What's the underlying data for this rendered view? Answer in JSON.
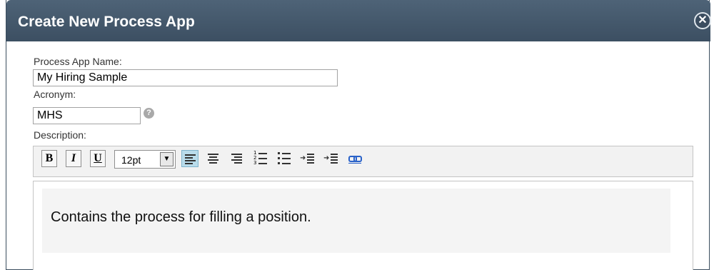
{
  "dialog": {
    "title": "Create New Process App",
    "close_icon": "close-icon"
  },
  "form": {
    "name_label": "Process App Name:",
    "name_value": "My Hiring Sample",
    "acronym_label": "Acronym:",
    "acronym_value": "MHS",
    "help_icon": "help-icon",
    "help_glyph": "?",
    "description_label": "Description:"
  },
  "toolbar": {
    "bold_label": "B",
    "italic_label": "I",
    "underline_label": "U",
    "font_size": "12pt",
    "icons": [
      "align-left-icon",
      "align-center-icon",
      "align-right-icon",
      "numbered-list-icon",
      "bullet-list-icon",
      "indent-icon",
      "outdent-icon",
      "link-icon"
    ]
  },
  "editor": {
    "text": "Contains the process for filling a position."
  },
  "colors": {
    "titlebar": "#4e6377",
    "selected_button": "#b9dceb"
  }
}
